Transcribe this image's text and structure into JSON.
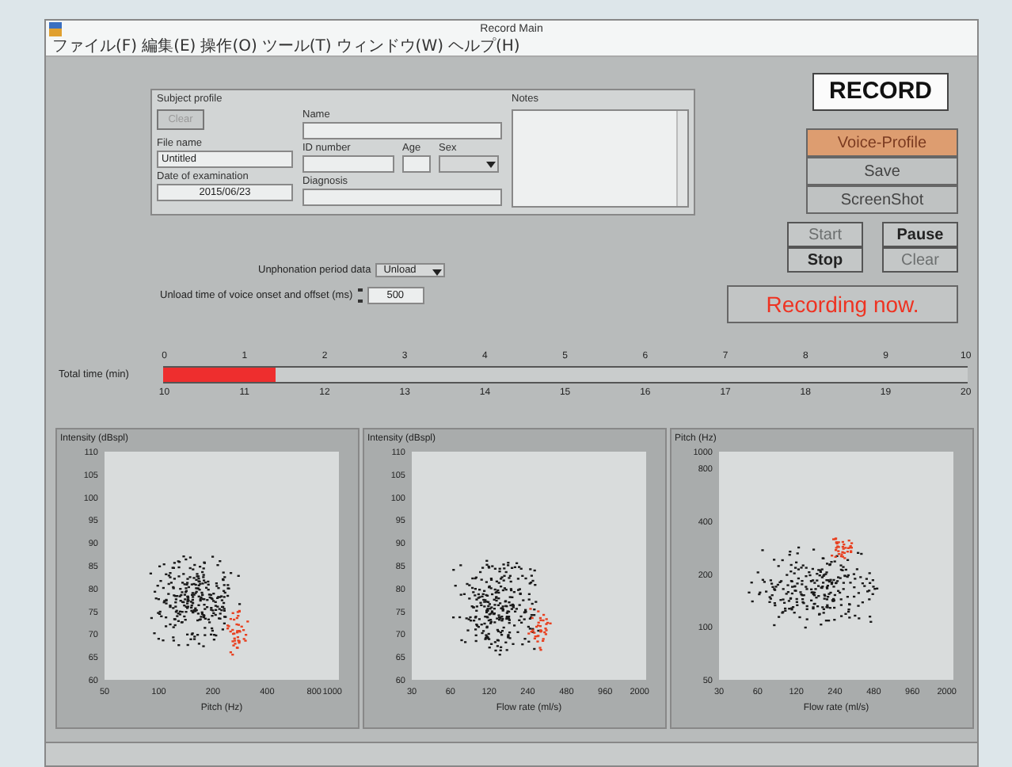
{
  "window": {
    "title": "Record Main"
  },
  "menu": [
    "ファイル(F)",
    "編集(E)",
    "操作(O)",
    "ツール(T)",
    "ウィンドウ(W)",
    "ヘルプ(H)"
  ],
  "subject_profile": {
    "title": "Subject profile",
    "clear_button": {
      "label": "Clear",
      "disabled": true
    },
    "name": {
      "label": "Name"
    },
    "file_name": {
      "label": "File name",
      "value": "Untitled"
    },
    "id_number": {
      "label": "ID number"
    },
    "age": {
      "label": "Age"
    },
    "sex": {
      "label": "Sex"
    },
    "date": {
      "label": "Date of examination",
      "value": "2015/06/23"
    },
    "diagnosis": {
      "label": "Diagnosis"
    },
    "notes": {
      "label": "Notes"
    }
  },
  "record_label": "RECORD",
  "side_buttons": [
    {
      "label": "Voice-Profile",
      "selected": true
    },
    {
      "label": "Save",
      "selected": false
    },
    {
      "label": "ScreenShot",
      "selected": false
    }
  ],
  "control_buttons": [
    {
      "label": "Start",
      "disabled": true
    },
    {
      "label": "Pause",
      "disabled": false
    },
    {
      "label": "Stop",
      "disabled": false
    },
    {
      "label": "Clear",
      "disabled": true
    }
  ],
  "status_message": "Recording now.",
  "unphonation": {
    "label": "Unphonation period data",
    "value": "Unload"
  },
  "unload_time": {
    "label": "Unload time of voice onset and offset (ms)",
    "value": "500"
  },
  "timeline": {
    "label": "Total time (min)",
    "level": 0.14,
    "top_ticks": [
      "0",
      "1",
      "2",
      "3",
      "4",
      "5",
      "6",
      "7",
      "8",
      "9",
      "10"
    ],
    "bottom_ticks": [
      "10",
      "11",
      "12",
      "13",
      "14",
      "15",
      "16",
      "17",
      "18",
      "19",
      "20"
    ]
  },
  "plots": [
    {
      "title": "Intensity (dBspl)",
      "xlabel": "Pitch (Hz)",
      "x_ticks": [
        "50",
        "100",
        "200",
        "400",
        "800",
        "1000"
      ],
      "y_ticks": [
        "110",
        "105",
        "100",
        "95",
        "90",
        "85",
        "80",
        "75",
        "70",
        "65",
        "60"
      ]
    },
    {
      "title": "Intensity (dBspl)",
      "xlabel": "Flow rate (ml/s)",
      "x_ticks": [
        "30",
        "60",
        "120",
        "240",
        "480",
        "960",
        "2000"
      ],
      "y_ticks": [
        "110",
        "105",
        "100",
        "95",
        "90",
        "85",
        "80",
        "75",
        "70",
        "65",
        "60"
      ]
    },
    {
      "title": "Pitch (Hz)",
      "xlabel": "Flow rate (ml/s)",
      "x_ticks": [
        "30",
        "60",
        "120",
        "240",
        "480",
        "960",
        "2000"
      ],
      "y_ticks": [
        "1000",
        "800",
        "400",
        "200",
        "100",
        "50"
      ]
    }
  ]
}
